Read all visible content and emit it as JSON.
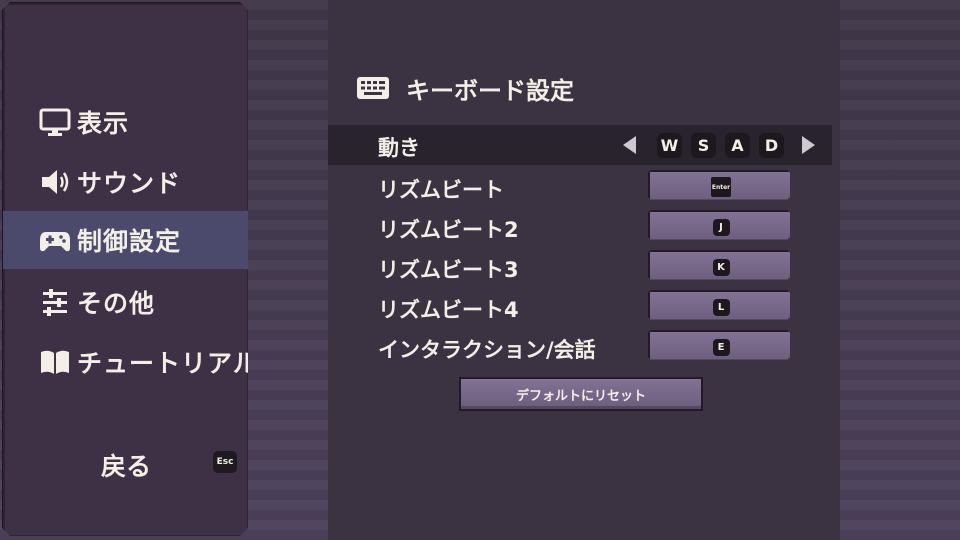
{
  "menu": {
    "items": [
      {
        "label": "表示",
        "icon": "monitor-icon"
      },
      {
        "label": "サウンド",
        "icon": "speaker-icon"
      },
      {
        "label": "制御設定",
        "icon": "gamepad-icon",
        "active": true
      },
      {
        "label": "その他",
        "icon": "sliders-icon"
      },
      {
        "label": "チュートリアル",
        "icon": "book-icon"
      }
    ],
    "back_label": "戻る",
    "back_key": "Esc"
  },
  "section": {
    "title": "キーボード設定",
    "icon": "keyboard-icon"
  },
  "movement": {
    "label": "動き",
    "keys": [
      "W",
      "S",
      "A",
      "D"
    ]
  },
  "bindings": [
    {
      "label": "リズムビート",
      "key": "Enter"
    },
    {
      "label": "リズムビート2",
      "key": "J"
    },
    {
      "label": "リズムビート3",
      "key": "K"
    },
    {
      "label": "リズムビート4",
      "key": "L"
    },
    {
      "label": "インタラクション/会話",
      "key": "E"
    }
  ],
  "reset_label": "デフォルトにリセット",
  "colors": {
    "panel": "#3e3145",
    "active_item": "#4b4a6c",
    "button": "#7b6c8e",
    "text": "#f3eee6"
  }
}
